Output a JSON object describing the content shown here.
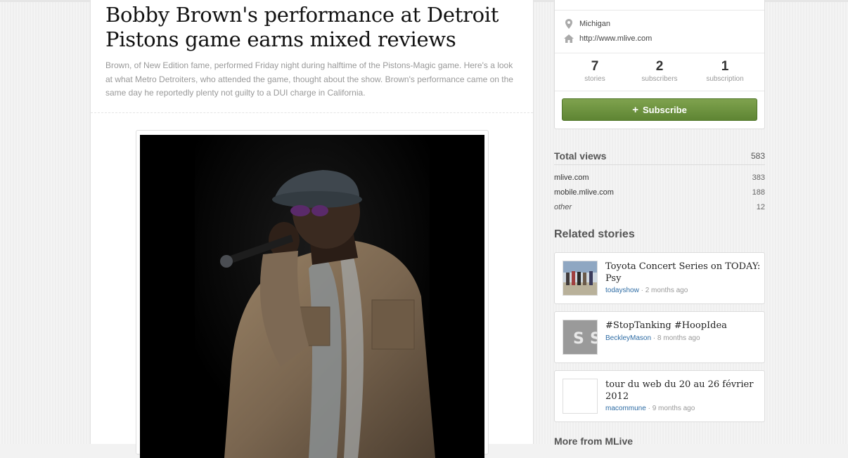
{
  "article": {
    "title": "Bobby Brown's performance at Detroit Pistons game earns mixed reviews",
    "description": "Brown, of New Edition fame, performed Friday night during halftime of the Pistons-Magic game. Here's a look at what Metro Detroiters, who attended the game, thought about the show. Brown's performance came on the same day he reportedly plenty not guilty to a DUI charge in California."
  },
  "profile": {
    "location": "Michigan",
    "website": "http://www.mlive.com",
    "stats": [
      {
        "value": "7",
        "label": "stories"
      },
      {
        "value": "2",
        "label": "subscribers"
      },
      {
        "value": "1",
        "label": "subscription"
      }
    ],
    "subscribe_label": "Subscribe",
    "icons": {
      "location": "map-pin-icon",
      "website": "home-icon",
      "subscribe": "plus-icon"
    }
  },
  "views": {
    "title": "Total views",
    "total": "583",
    "rows": [
      {
        "source": "mlive.com",
        "count": "383"
      },
      {
        "source": "mobile.mlive.com",
        "count": "188"
      },
      {
        "source": "other",
        "count": "12"
      }
    ]
  },
  "related": {
    "title": "Related stories",
    "items": [
      {
        "title": "Toyota Concert Series on TODAY: Psy",
        "author": "todayshow",
        "age": " · 2 months ago"
      },
      {
        "title": "#StopTanking #HoopIdea",
        "author": "BeckleyMason",
        "age": " · 8 months ago"
      },
      {
        "title": "tour du web du 20 au 26 février 2012",
        "author": "macommune",
        "age": " · 9 months ago"
      }
    ]
  },
  "more": {
    "title": "More from MLive"
  },
  "colors": {
    "accent_green": "#6a9140",
    "link_blue": "#2e6ca4"
  }
}
